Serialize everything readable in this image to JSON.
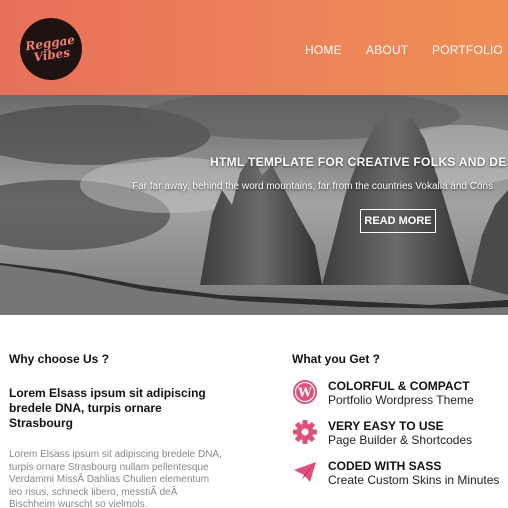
{
  "header": {
    "logo_line1": "Reggae",
    "logo_line2": "Vibes",
    "nav": [
      "HOME",
      "ABOUT",
      "PORTFOLIO"
    ],
    "gradient_start": "#e8705a",
    "gradient_end": "#f08f55"
  },
  "hero": {
    "title": "HTML TEMPLATE FOR CREATIVE FOLKS AND DES",
    "subtitle": "Far far away, behind the word mountains, far from the countries Vokalia and Cons",
    "button_label": "READ MORE"
  },
  "why": {
    "heading": "Why choose Us ?",
    "lead": "Lorem Elsass ipsum sit adipiscing bredele DNA, turpis ornare Strasbourg",
    "paragraph": "Lorem Elsass ipsum sit adipiscing bredele DNA, turpis ornare Strasbourg nullam pellentesque Verdammi MissÂ Dahlias Chulien elementum leo risus, schneck libero, messtiÃ deÂ Bischheim wurscht so vielmols."
  },
  "get": {
    "heading": "What you Get ?",
    "accent_color": "#e0507a",
    "features": [
      {
        "icon": "wordpress-icon",
        "title": "COLORFUL & COMPACT",
        "desc": "Portfolio Wordpress Theme"
      },
      {
        "icon": "gear-icon",
        "title": "VERY EASY TO USE",
        "desc": "Page Builder & Shortcodes"
      },
      {
        "icon": "paper-plane-icon",
        "title": "CODED WITH SASS",
        "desc": "Create Custom Skins in Minutes"
      }
    ]
  }
}
